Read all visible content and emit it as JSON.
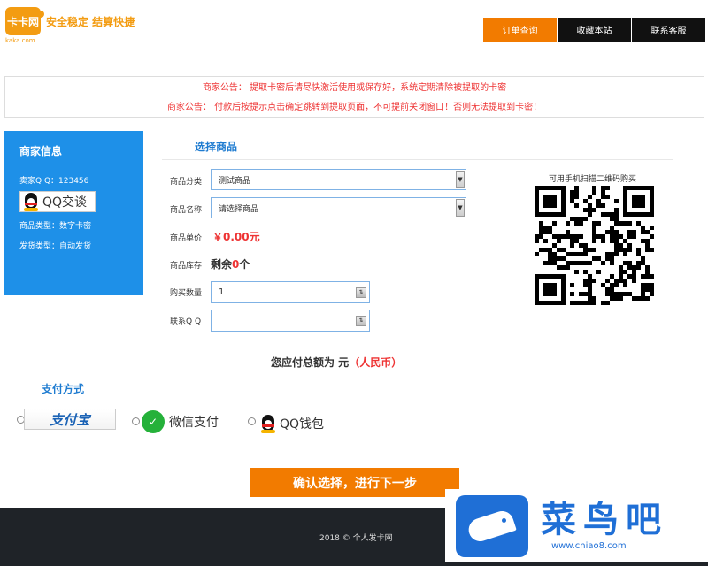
{
  "header": {
    "logo_mark": "卡卡网",
    "logo_sub": "kaka.com",
    "slogan": "安全稳定 结算快捷",
    "nav": [
      {
        "label": "订单查询",
        "active": true
      },
      {
        "label": "收藏本站",
        "active": false
      },
      {
        "label": "联系客服",
        "active": false
      }
    ]
  },
  "notice": {
    "line1": "商家公告： 提取卡密后请尽快激活使用或保存好，系统定期清除被提取的卡密",
    "line2": "商家公告： 付款后按提示点击确定跳转到提取页面，不可提前关闭窗口！否则无法提取到卡密！"
  },
  "merchant": {
    "title": "商家信息",
    "seller_qq": "卖家Q Q：123456",
    "qq_chat": "QQ交谈",
    "product_type": "商品类型：数字卡密",
    "delivery_type": "发货类型：自动发货"
  },
  "product": {
    "section_title": "选择商品",
    "category_label": "商品分类",
    "category_value": "测试商品",
    "name_label": "商品名称",
    "name_value": "请选择商品",
    "price_label": "商品单价",
    "price_value": "￥0.00元",
    "stock_label": "商品库存",
    "stock_prefix": "剩余",
    "stock_count": "0",
    "stock_suffix": "个",
    "qty_label": "购买数量",
    "qty_value": "1",
    "contact_label": "联系Q Q",
    "contact_value": ""
  },
  "qr": {
    "caption": "可用手机扫描二维码购买"
  },
  "total": {
    "prefix": "您应付总额为 元",
    "currency": "（人民币）"
  },
  "payment": {
    "title": "支付方式",
    "alipay": "支付宝",
    "wechat": "微信支付",
    "qqwallet": "QQ钱包"
  },
  "confirm_label": "确认选择，进行下一步",
  "footer": {
    "text": "2018 © 个人发卡网"
  },
  "watermark": {
    "name": "菜鸟吧",
    "url": "www.cniao8.com"
  },
  "colors": {
    "accent": "#f27b00",
    "merchant_bg": "#1e90e8",
    "notice_text": "#e33333",
    "section_blue": "#1e7bd0",
    "footer_bg": "#1f2328"
  }
}
